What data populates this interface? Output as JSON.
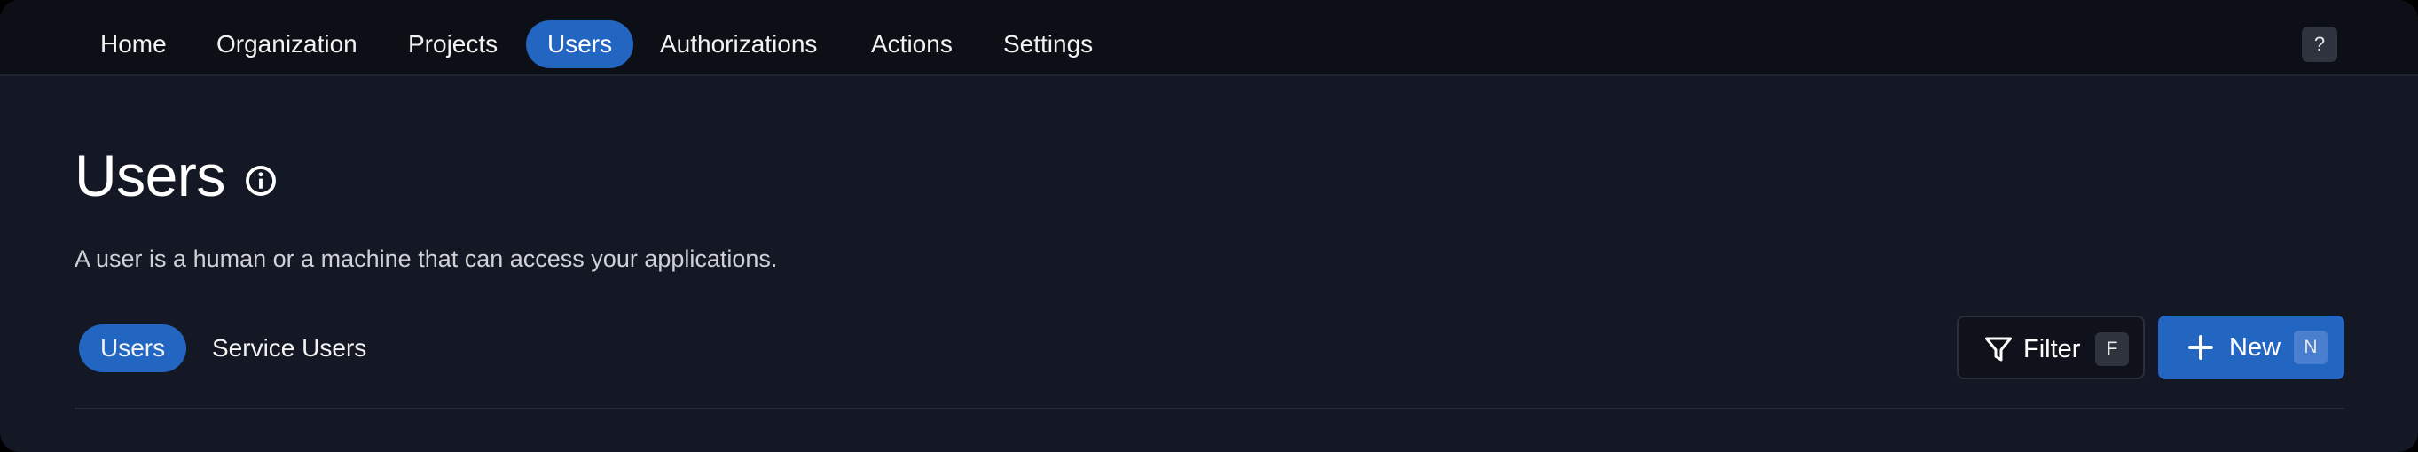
{
  "nav": {
    "items": [
      {
        "label": "Home"
      },
      {
        "label": "Organization"
      },
      {
        "label": "Projects"
      },
      {
        "label": "Users",
        "active": true
      },
      {
        "label": "Authorizations"
      },
      {
        "label": "Actions"
      },
      {
        "label": "Settings"
      }
    ],
    "help_label": "?"
  },
  "page": {
    "title": "Users",
    "description": "A user is a human or a machine that can access your applications."
  },
  "tabs": [
    {
      "label": "Users",
      "active": true
    },
    {
      "label": "Service Users"
    }
  ],
  "actions": {
    "filter_label": "Filter",
    "filter_shortcut": "F",
    "new_label": "New",
    "new_shortcut": "N"
  },
  "colors": {
    "accent": "#2266c2",
    "background": "#141824",
    "nav_background": "#0d0f16"
  },
  "icons": {
    "info": "info-circle-icon",
    "filter": "filter-funnel-icon",
    "new": "plus-icon"
  }
}
